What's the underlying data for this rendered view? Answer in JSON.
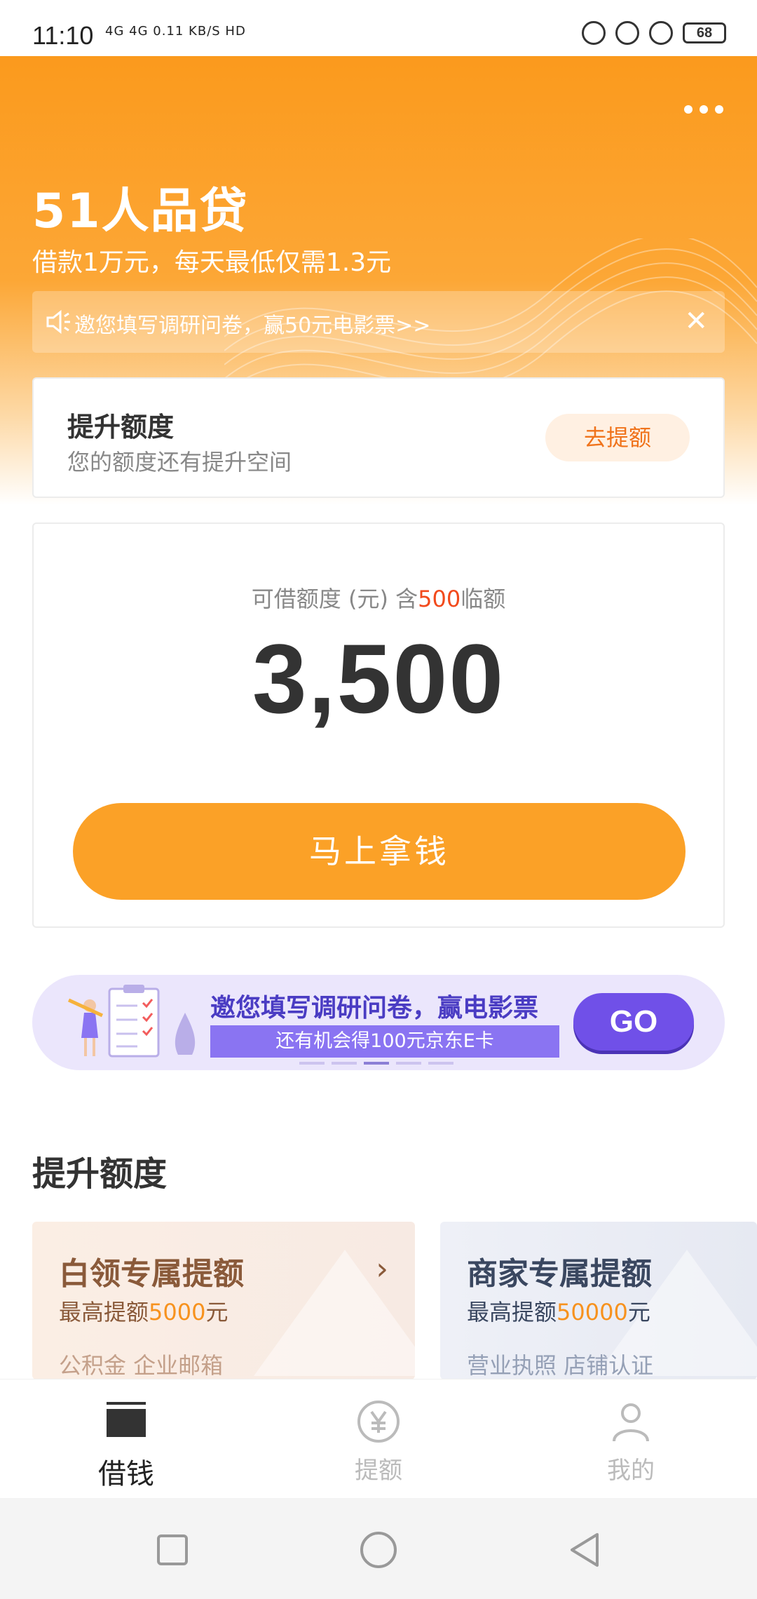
{
  "status_bar": {
    "time": "11:10",
    "network": "4G 4G 0.11 KB/S HD",
    "battery": "68"
  },
  "header": {
    "brand": "51人品贷",
    "subtitle": "借款1万元，每天最低仅需1.3元",
    "notice": "邀您填写调研问卷，赢50元电影票>>"
  },
  "promote": {
    "title": "提升额度",
    "subtitle": "您的额度还有提升空间",
    "button": "去提额"
  },
  "limit": {
    "label_prefix": "可借额度 (元) 含",
    "temp_amount": "500",
    "label_suffix": "临额",
    "amount": "3,500",
    "button": "马上拿钱"
  },
  "banner": {
    "title": "邀您填写调研问卷，赢电影票",
    "strip": "还有机会得100元京东E卡",
    "go": "GO"
  },
  "section": {
    "title": "提升额度"
  },
  "quota_cards": [
    {
      "title": "白领专属提额",
      "sub_prefix": "最高提额",
      "amount": "5000",
      "sub_suffix": "元",
      "tags": "公积金  企业邮箱"
    },
    {
      "title": "商家专属提额",
      "sub_prefix": "最高提额",
      "amount": "50000",
      "sub_suffix": "元",
      "tags": "营业执照  店铺认证"
    }
  ],
  "tabbar": [
    {
      "label": "借钱",
      "icon": "wallet-icon"
    },
    {
      "label": "提额",
      "icon": "yen-icon"
    },
    {
      "label": "我的",
      "icon": "person-icon"
    }
  ],
  "colors": {
    "brand_orange": "#fba127",
    "accent_red": "#f24a1c",
    "banner_purple": "#7050e8"
  }
}
